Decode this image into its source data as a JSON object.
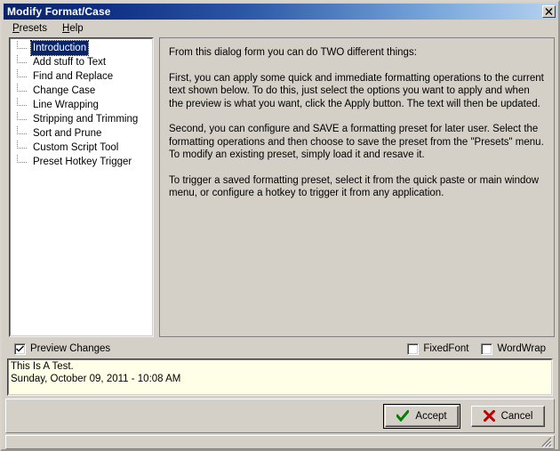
{
  "window": {
    "title": "Modify Format/Case",
    "close_icon": "close-icon"
  },
  "menubar": {
    "items": [
      {
        "label": "Presets",
        "accel": "P"
      },
      {
        "label": "Help",
        "accel": "H"
      }
    ]
  },
  "tree": {
    "items": [
      {
        "label": "Introduction",
        "selected": true
      },
      {
        "label": "Add stuff to Text",
        "selected": false
      },
      {
        "label": "Find and Replace",
        "selected": false
      },
      {
        "label": "Change Case",
        "selected": false
      },
      {
        "label": "Line Wrapping",
        "selected": false
      },
      {
        "label": "Stripping and Trimming",
        "selected": false
      },
      {
        "label": "Sort and Prune",
        "selected": false
      },
      {
        "label": "Custom Script Tool",
        "selected": false
      },
      {
        "label": "Preset Hotkey Trigger",
        "selected": false
      }
    ]
  },
  "info": {
    "paragraphs": [
      "From this dialog form you can do TWO different things:",
      "First, you can apply some quick and immediate formatting operations to the current text shown below.  To do this, just select the options you want to apply and when the preview is what you want, click the Apply button.  The text will then be updated.",
      "Second, you can configure and SAVE a formatting preset for later user.  Select the formatting operations and then choose to save the preset from the \"Presets\" menu.  To modify an existing preset, simply load it and resave it.",
      "To trigger a saved formatting preset, select it from the quick paste or main window menu, or configure a hotkey to trigger it from any application."
    ]
  },
  "options": {
    "preview_changes": {
      "label": "Preview Changes",
      "checked": true
    },
    "fixed_font": {
      "label": "FixedFont",
      "checked": false
    },
    "word_wrap": {
      "label": "WordWrap",
      "checked": false
    }
  },
  "preview": {
    "lines": [
      "This Is A Test.",
      "Sunday, October 09, 2011 - 10:08 AM"
    ]
  },
  "buttons": {
    "accept": {
      "label": "Accept",
      "icon": "check-icon",
      "color": "#008000"
    },
    "cancel": {
      "label": "Cancel",
      "icon": "x-icon",
      "color": "#c00000"
    }
  },
  "colors": {
    "title_start": "#0a246a",
    "title_end": "#b6d2f0",
    "face": "#d4d0c8",
    "selection": "#0a246a",
    "preview_bg": "#ffffe8"
  }
}
